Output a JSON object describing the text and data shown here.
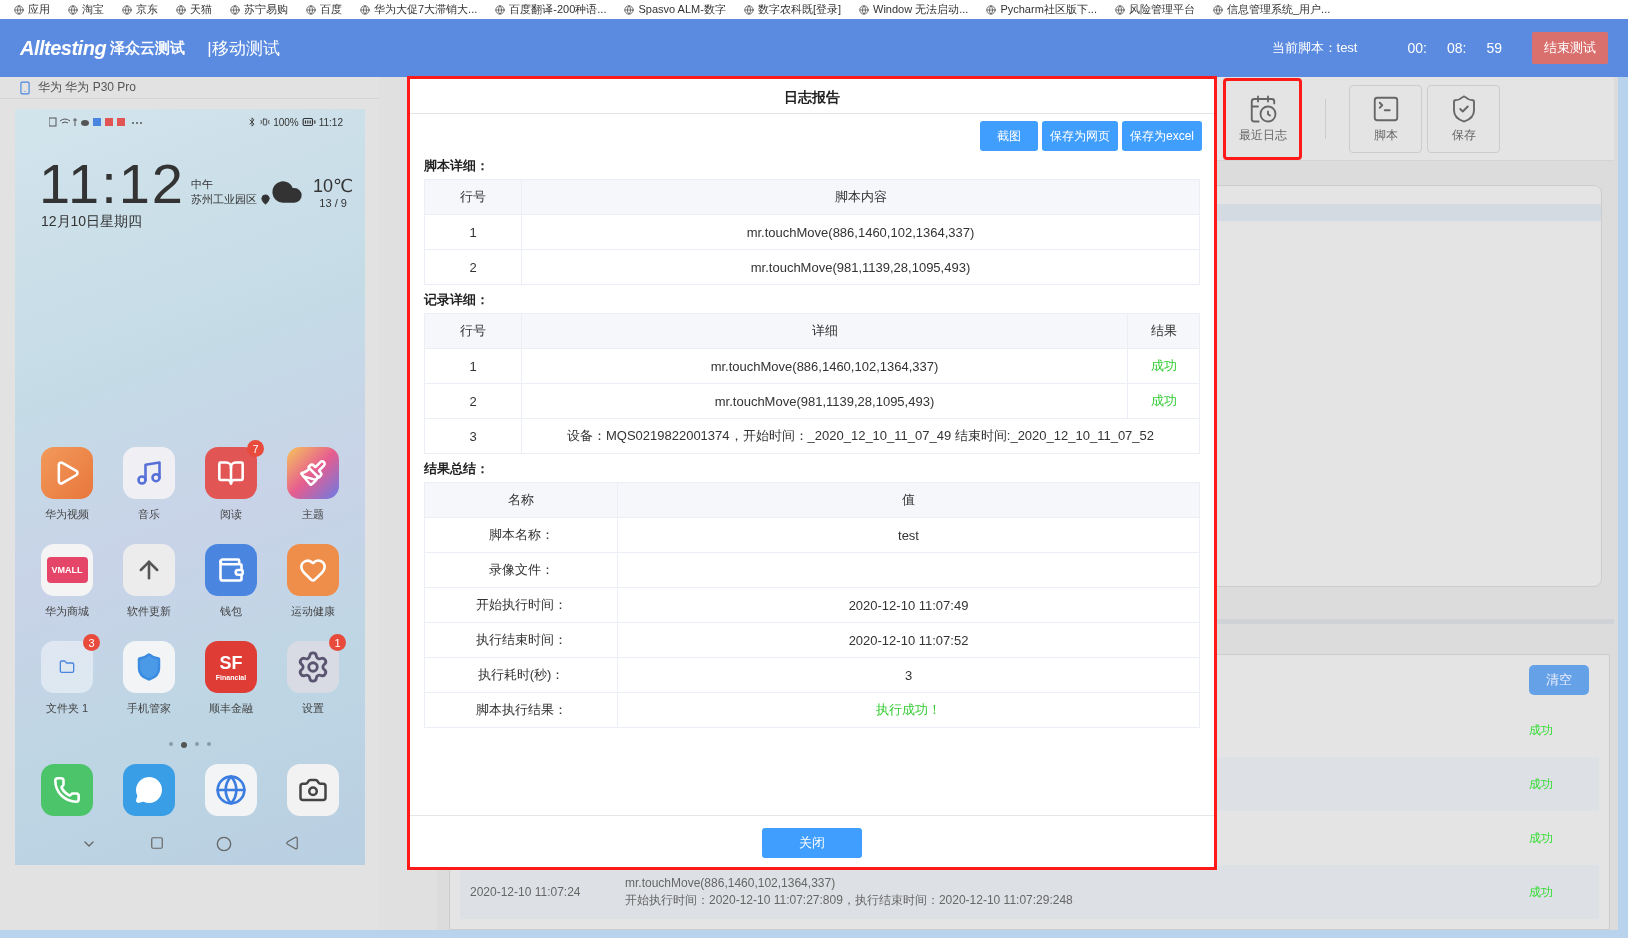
{
  "bookmarks": [
    "应用",
    "淘宝",
    "京东",
    "天猫",
    "苏宁易购",
    "百度",
    "华为大促7大滞销大...",
    "百度翻译-200种语...",
    "Spasvo ALM-数字",
    "数字农科既[登录]",
    "Window 无法启动...",
    "Pycharm社区版下...",
    "风险管理平台",
    "信息管理系统_用户..."
  ],
  "header": {
    "logo": "Alltesting",
    "brand": "泽众云测试",
    "section": "|移动测试",
    "script_label": "当前脚本：test",
    "timer": [
      "00:",
      "08:",
      "59"
    ],
    "end_button": "结束测试"
  },
  "device": {
    "name": "华为 华为 P30 Pro",
    "status_bar": {
      "battery": "100%",
      "time": "11:12"
    },
    "clock": {
      "time": "11:12",
      "period": "中午",
      "location": "苏州工业园区",
      "date": "12月10日星期四",
      "temperature": "10℃",
      "range": "13 / 9"
    },
    "apps": [
      {
        "label": "华为视频",
        "kind": "video"
      },
      {
        "label": "音乐",
        "kind": "music"
      },
      {
        "label": "阅读",
        "kind": "book",
        "badge": "7"
      },
      {
        "label": "主题",
        "kind": "theme"
      },
      {
        "label": "华为商城",
        "kind": "mall",
        "logo_text": "VMALL"
      },
      {
        "label": "软件更新",
        "kind": "update"
      },
      {
        "label": "钱包",
        "kind": "wallet"
      },
      {
        "label": "运动健康",
        "kind": "health"
      },
      {
        "label": "文件夹 1",
        "kind": "folder",
        "badge": "3"
      },
      {
        "label": "手机管家",
        "kind": "shield"
      },
      {
        "label": "顺丰金融",
        "kind": "sf",
        "logo_text": "SF",
        "sub_text": "Financial"
      },
      {
        "label": "设置",
        "kind": "settings",
        "badge": "1"
      }
    ],
    "page_dots": [
      {
        "selected": false
      },
      {
        "selected": true
      },
      {
        "selected": false
      },
      {
        "selected": false
      }
    ],
    "dock": [
      {
        "kind": "phone"
      },
      {
        "kind": "message"
      },
      {
        "kind": "browser"
      },
      {
        "kind": "camera"
      }
    ]
  },
  "toolbar": [
    {
      "label": "最近日志",
      "kind": "log",
      "highlighted": true
    },
    {
      "label": "脚本",
      "kind": "script",
      "highlighted": false
    },
    {
      "label": "保存",
      "kind": "save",
      "highlighted": false
    }
  ],
  "log_panel": {
    "clear_button": "清空",
    "rows": [
      {
        "status": "成功"
      },
      {
        "status": "成功"
      },
      {
        "status": "成功"
      },
      {
        "status": "成功",
        "time": "2020-12-10 11:07:24",
        "lines": [
          "mr.touchMove(886,1460,102,1364,337)",
          "开始执行时间：2020-12-10 11:07:27:809，执行结束时间：2020-12-10 11:07:29:248"
        ]
      }
    ]
  },
  "dialog": {
    "title": "日志报告",
    "actions": [
      "截图",
      "保存为网页",
      "保存为excel"
    ],
    "script": {
      "label": "脚本详细：",
      "columns": [
        "行号",
        "脚本内容"
      ],
      "rows": [
        [
          "1",
          "mr.touchMove(886,1460,102,1364,337)"
        ],
        [
          "2",
          "mr.touchMove(981,1139,28,1095,493)"
        ]
      ]
    },
    "records": {
      "label": "记录详细：",
      "columns": [
        "行号",
        "详细",
        "结果"
      ],
      "rows": [
        {
          "no": "1",
          "detail": "mr.touchMove(886,1460,102,1364,337)",
          "result": "成功",
          "success": true
        },
        {
          "no": "2",
          "detail": "mr.touchMove(981,1139,28,1095,493)",
          "result": "成功",
          "success": true
        },
        {
          "no": "3",
          "detail": "设备：MQS0219822001374，开始时间：_2020_12_10_11_07_49 结束时间:_2020_12_10_11_07_52"
        }
      ]
    },
    "summary": {
      "label": "结果总结：",
      "columns": [
        "名称",
        "值"
      ],
      "rows": [
        {
          "name": "脚本名称：",
          "value": "test",
          "success": false
        },
        {
          "name": "录像文件："
        },
        {
          "name": "开始执行时间：",
          "value": "2020-12-10 11:07:49",
          "success": false
        },
        {
          "name": "执行结束时间：",
          "value": "2020-12-10 11:07:52",
          "success": false
        },
        {
          "name": "执行耗时(秒)：",
          "value": "3",
          "success": false
        },
        {
          "name": "脚本执行结果：",
          "value": "执行成功！",
          "success": true
        }
      ]
    },
    "close_button": "关闭"
  }
}
